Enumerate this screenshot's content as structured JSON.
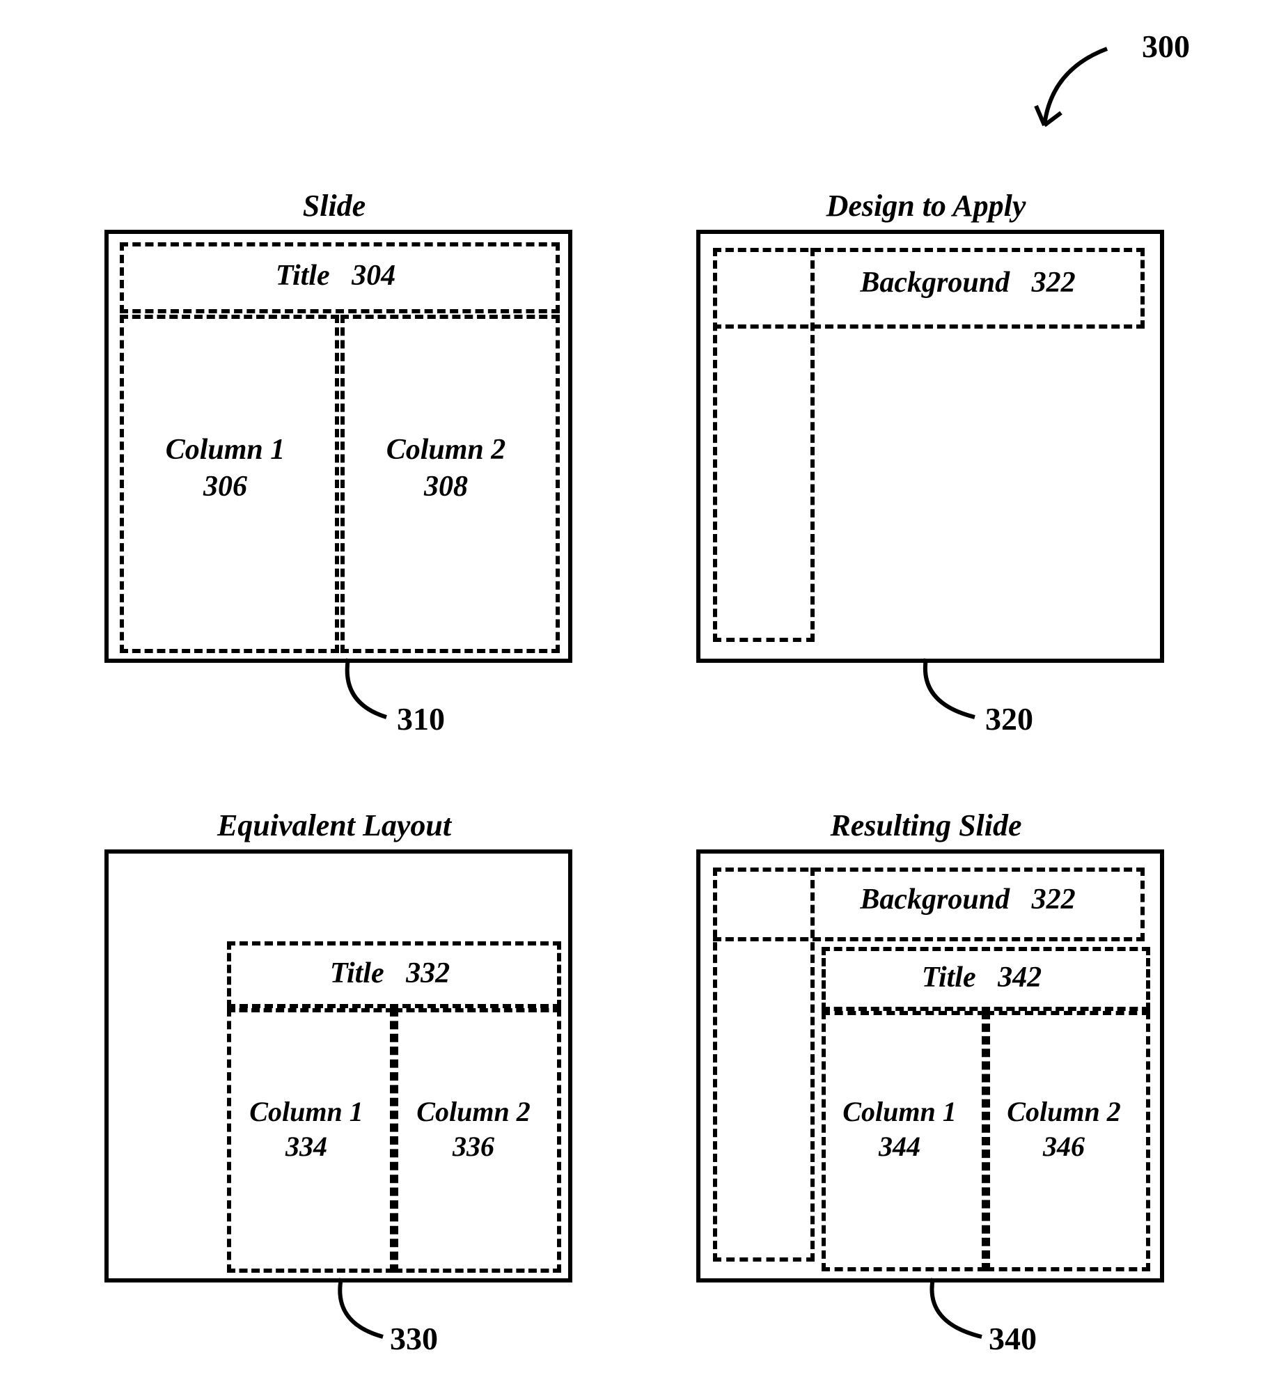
{
  "figure_ref": "300",
  "slide": {
    "heading": "Slide",
    "title_label": "Title   304",
    "col1_label": "Column 1\n306",
    "col2_label": "Column 2\n308",
    "ref": "310"
  },
  "design": {
    "heading": "Design to Apply",
    "bg_label": "Background   322",
    "ref": "320"
  },
  "equiv": {
    "heading": "Equivalent Layout",
    "title_label": "Title   332",
    "col1_label": "Column 1\n334",
    "col2_label": "Column 2\n336",
    "ref": "330"
  },
  "result": {
    "heading": "Resulting Slide",
    "bg_label": "Background   322",
    "title_label": "Title   342",
    "col1_label": "Column 1\n344",
    "col2_label": "Column 2\n346",
    "ref": "340"
  }
}
